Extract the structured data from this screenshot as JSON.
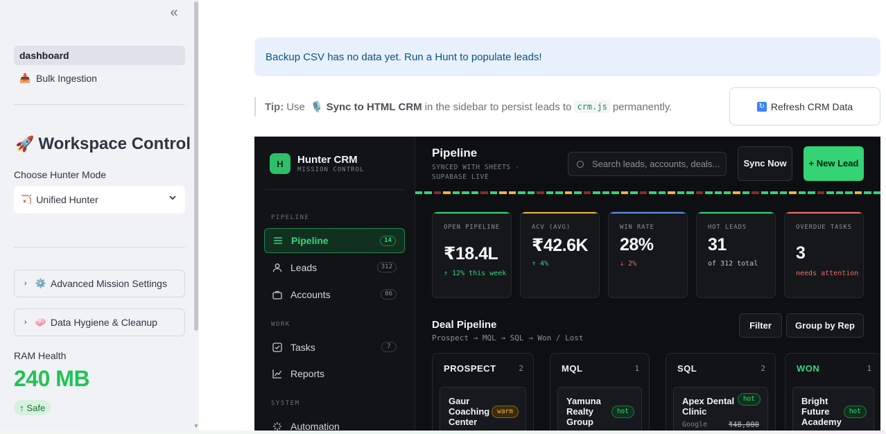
{
  "sidebar": {
    "collapse_icon": "double-chevron-left-icon",
    "nav": [
      {
        "label": "dashboard",
        "active": true
      },
      {
        "label": "Bulk Ingestion",
        "icon": "📥",
        "active": false
      }
    ],
    "workspace_title": "Workspace Control",
    "workspace_emoji": "🚀",
    "mode_label": "Choose Hunter Mode",
    "mode_value": "Unified Hunter",
    "mode_emoji": "🏹",
    "expanders": [
      {
        "label": "Advanced Mission Settings",
        "emoji": "⚙️"
      },
      {
        "label": "Data Hygiene & Cleanup",
        "emoji": "🧼"
      }
    ],
    "ram_label": "RAM Health",
    "ram_value": "240 MB",
    "ram_delta": "Safe",
    "ram_delta_arrow": "↑"
  },
  "main": {
    "alert": "Backup CSV has no data yet. Run a Hunt to populate leads!",
    "tip": {
      "prefix": "Tip:",
      "use": "Use",
      "emoji": "🎙️",
      "sync_label": "Sync to HTML CRM",
      "middle": "in the sidebar to persist leads to",
      "code": "crm.js",
      "suffix": "permanently."
    },
    "refresh_label": "Refresh CRM Data",
    "refresh_icon": "🔄"
  },
  "crm": {
    "logo_letter": "H",
    "brand": "Hunter CRM",
    "brand_sub": "MISSION CONTROL",
    "sections": {
      "pipeline": "PIPELINE",
      "work": "WORK",
      "system": "SYSTEM"
    },
    "nav": [
      {
        "label": "Pipeline",
        "count": "14",
        "active": true
      },
      {
        "label": "Leads",
        "count": "312"
      },
      {
        "label": "Accounts",
        "count": "86"
      },
      {
        "label": "Tasks",
        "count": "7"
      },
      {
        "label": "Reports"
      },
      {
        "label": "Automation"
      }
    ],
    "title": "Pipeline",
    "subtitle": "SYNCED WITH SHEETS · SUPABASE LIVE",
    "search_placeholder": "Search leads, accounts, deals...",
    "sync_btn": "Sync Now",
    "new_btn": "+ New Lead",
    "colors": {
      "green": "#34d375",
      "amber": "#f0b43c",
      "red": "#8b2a2a",
      "blue": "#5b8ff0",
      "coral": "#f06a6a"
    },
    "kpis": [
      {
        "label": "OPEN PIPELINE",
        "value": "₹18.4L",
        "delta": "↑ 12% this week",
        "delta_color": "#37d67a",
        "bar": "#34d375"
      },
      {
        "label": "ACV (AVG)",
        "value": "₹42.6K",
        "delta": "↑ 4%",
        "delta_color": "#37d67a",
        "bar": "#f0b43c"
      },
      {
        "label": "WIN RATE",
        "value": "28%",
        "delta": "↓ 2%",
        "delta_color": "#f06a6a",
        "bar": "#5b8ff0"
      },
      {
        "label": "HOT LEADS",
        "value": "31",
        "delta": "of 312 total",
        "delta_color": "#c4c7cd",
        "bar": "#34d375"
      },
      {
        "label": "OVERDUE TASKS",
        "value": "3",
        "delta": "needs attention",
        "delta_color": "#f06a6a",
        "bar": "#f06a6a"
      }
    ],
    "deal_title": "Deal Pipeline",
    "deal_sub": "Prospect → MQL → SQL → Won / Lost",
    "filter_btn": "Filter",
    "group_btn": "Group by Rep",
    "columns": [
      {
        "name": "PROSPECT",
        "count": "2",
        "card": {
          "name": "Gaur Coaching Center",
          "tag": "warm"
        }
      },
      {
        "name": "MQL",
        "count": "1",
        "card": {
          "name": "Yamuna Realty Group",
          "tag": "hot"
        }
      },
      {
        "name": "SQL",
        "count": "2",
        "card": {
          "name": "Apex Dental Clinic",
          "tag": "hot",
          "source": "Google",
          "amount": "₹48,000"
        }
      },
      {
        "name": "WON",
        "count": "1",
        "card": {
          "name": "Bright Future Academy",
          "tag": "hot"
        }
      }
    ]
  }
}
